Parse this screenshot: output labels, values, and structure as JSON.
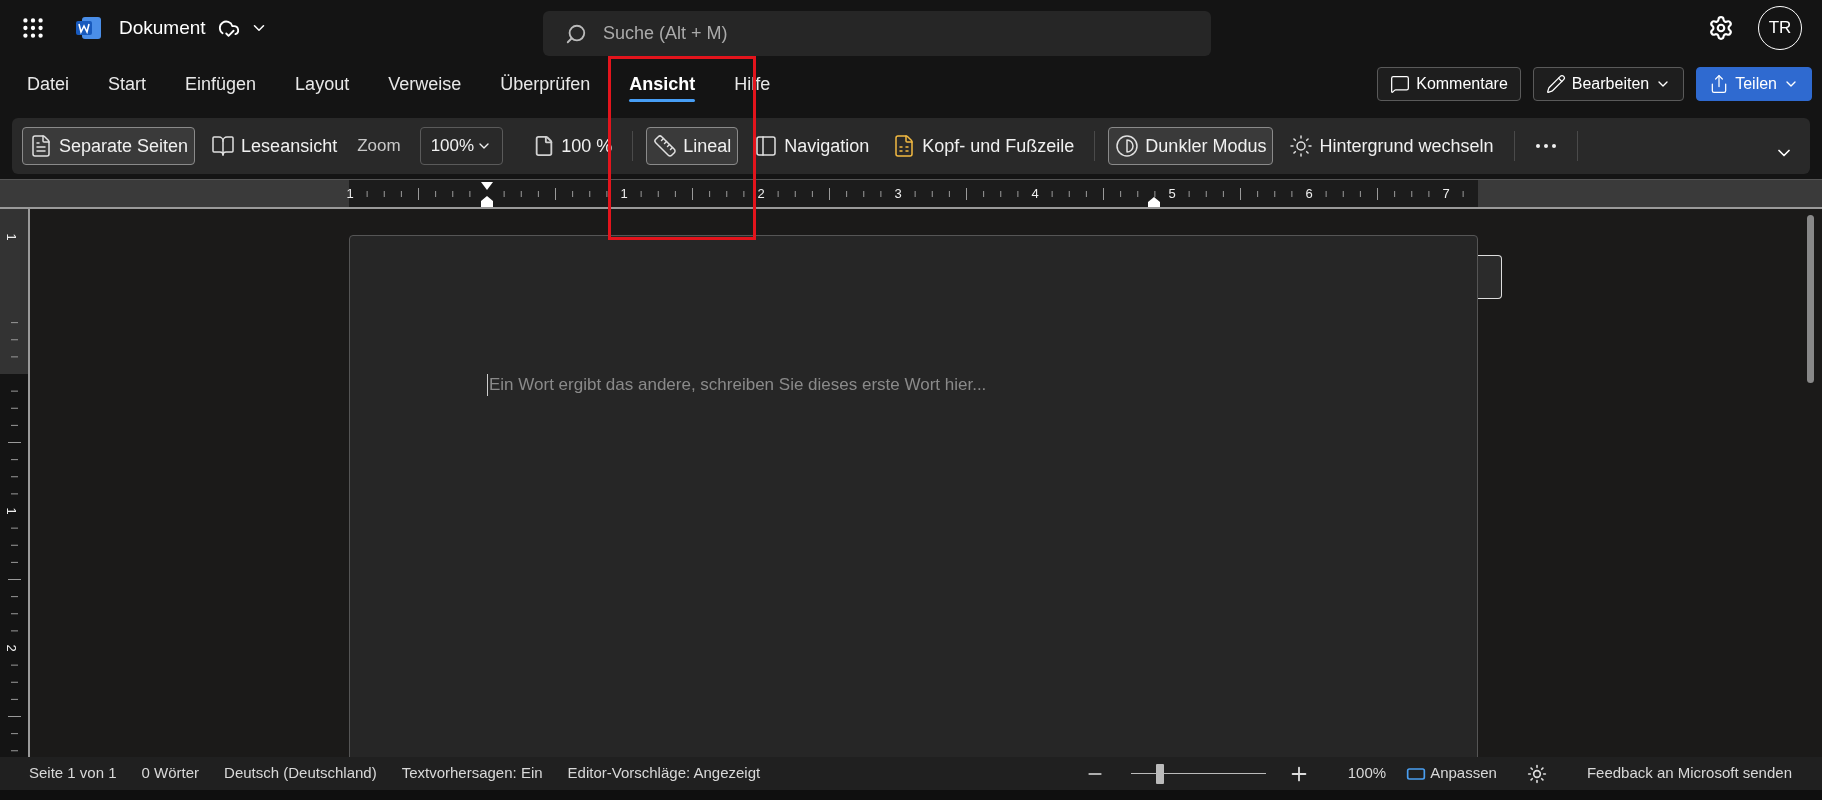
{
  "app": {
    "title": "Dokument"
  },
  "search": {
    "placeholder": "Suche (Alt + M)"
  },
  "account": {
    "initials": "TR"
  },
  "tabs": [
    {
      "label": "Datei",
      "selected": false
    },
    {
      "label": "Start",
      "selected": false
    },
    {
      "label": "Einfügen",
      "selected": false
    },
    {
      "label": "Layout",
      "selected": false
    },
    {
      "label": "Verweise",
      "selected": false
    },
    {
      "label": "Überprüfen",
      "selected": false
    },
    {
      "label": "Ansicht",
      "selected": true
    },
    {
      "label": "Hilfe",
      "selected": false
    }
  ],
  "actions": [
    {
      "kind": "comments",
      "label": "Kommentare"
    },
    {
      "kind": "edit",
      "label": "Bearbeiten"
    },
    {
      "kind": "share",
      "label": "Teilen"
    }
  ],
  "ribbon": [
    {
      "kind": "pages",
      "label": "Separate Seiten",
      "selected": true
    },
    {
      "kind": "reader",
      "label": "Leseansicht",
      "selected": false
    },
    {
      "kind": "label",
      "label": "Zoom"
    },
    {
      "kind": "select",
      "label": "100%"
    },
    {
      "kind": "zoom100",
      "label": "100 %"
    },
    {
      "kind": "separator"
    },
    {
      "kind": "ruler",
      "label": "Lineal",
      "selected": true
    },
    {
      "kind": "navigation",
      "label": "Navigation",
      "selected": false
    },
    {
      "kind": "headerfooter",
      "label": "Kopf- und Fußzeile"
    },
    {
      "kind": "separator"
    },
    {
      "kind": "darkmode",
      "label": "Dunkler Modus",
      "selected": true
    },
    {
      "kind": "background",
      "label": "Hintergrund wechseln"
    },
    {
      "kind": "separator"
    },
    {
      "kind": "more"
    },
    {
      "kind": "separator"
    }
  ],
  "ruler": {
    "horizontal": [
      "1",
      "1",
      "2",
      "3",
      "4",
      "5",
      "6",
      "7"
    ],
    "vertical": [
      "1",
      "1",
      "2"
    ]
  },
  "document": {
    "placeholder": "Ein Wort ergibt das andere, schreiben Sie dieses erste Wort hier..."
  },
  "status_bar": {
    "items": [
      "Seite 1 von 1",
      "0 Wörter",
      "Deutsch (Deutschland)",
      "Textvorhersagen: Ein",
      "Editor-Vorschläge: Angezeigt"
    ],
    "zoom": {
      "level": 0.22,
      "reading": "100%"
    },
    "fit": "Anpassen",
    "feedback": "Feedback an Microsoft senden"
  }
}
